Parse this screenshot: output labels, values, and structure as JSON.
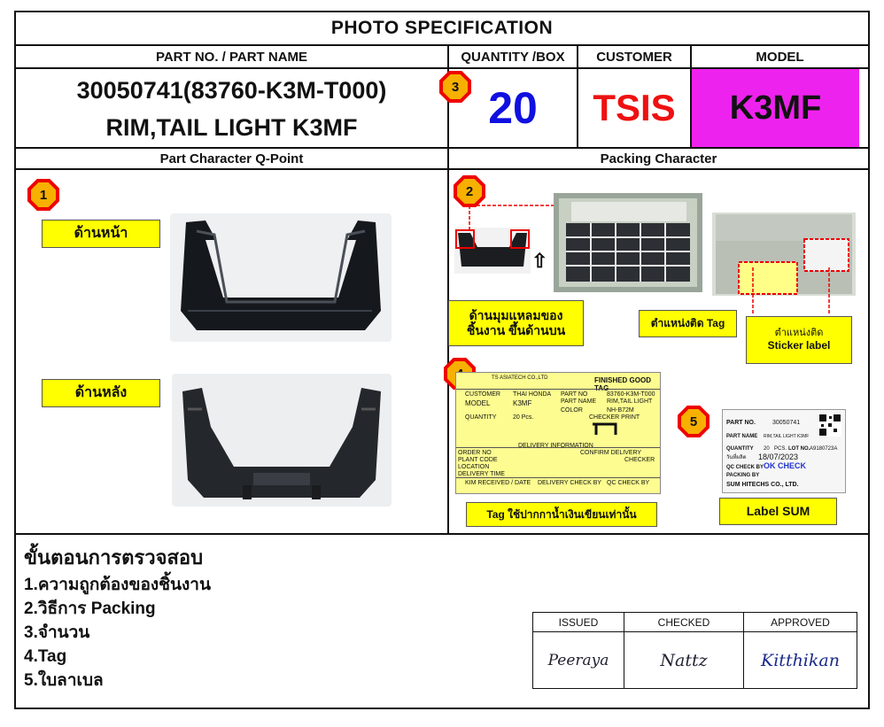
{
  "title": "PHOTO  SPECIFICATION",
  "headers": {
    "part": "PART NO. / PART NAME",
    "quantity": "QUANTITY /BOX",
    "customer": "CUSTOMER",
    "model": "MODEL"
  },
  "part": {
    "number": "30050741(83760-K3M-T000)",
    "name": "RIM,TAIL LIGHT K3MF"
  },
  "quantity": "20",
  "customer": "TSIS",
  "model": "K3MF",
  "colors": {
    "quantity": "#1010e0",
    "customer": "#ee1111",
    "model_bg": "#ee22ee",
    "marker_red": "#ee0000",
    "marker_orange": "#f7b000",
    "note_yellow": "#ffff00"
  },
  "sections": {
    "left": "Part Character Q-Point",
    "right": "Packing Character"
  },
  "markers": [
    "1",
    "2",
    "3",
    "4",
    "5"
  ],
  "labels": {
    "front": "ด้านหน้า",
    "back": "ด้านหลัง",
    "corner": "ด้านมุมแหลมของ\nชิ้นงาน ขึ้นด้านบน",
    "tag_pos": "ตำแหน่งติด Tag",
    "sticker_pos_line1": "ตำแหน่งติด",
    "sticker_pos_line2": "Sticker label",
    "tag_note": "Tag ใช้ปากกาน้ำเงินเขียนเท่านั้น",
    "label_sum": "Label SUM"
  },
  "tag_card": {
    "heading": "FINISHED GOOD TAG",
    "company": "TS ASIATECH CO.,LTD",
    "customer_label": "CUSTOMER",
    "customer_value": "THAI HONDA",
    "model_label": "MODEL",
    "model_value": "K3MF",
    "part_no_label": "PART NO",
    "part_no_value": "83760-K3M-T000",
    "part_name_label": "PART NAME",
    "part_name_value": "RIM,TAIL LIGHT",
    "color_label": "COLOR",
    "color_value": "NH-B72M",
    "quantity_label": "QUANTITY",
    "quantity_value": "20 Pcs.",
    "checker_label": "CHECKER PRINT",
    "delivery_label": "DELIVERY INFORMATION",
    "order_no": "ORDER NO",
    "plant_code": "PLANT CODE",
    "location": "LOCATION",
    "delivery_time": "DELIVERY TIME",
    "confirm_delivery": "CONFIRM DELIVERY",
    "checker": "CHECKER",
    "kim_received": "KIM RECEIVED / DATE",
    "delivery_check": "DELIVERY CHECK BY",
    "qc_check": "QC CHECK BY"
  },
  "sum_label": {
    "part_no_label": "PART NO.",
    "part_no_value": "30050741",
    "part_name_label": "PART NAME",
    "part_name_value": "RIM,TAIL LIGHT K3MF",
    "quantity_label": "QUANTITY",
    "quantity_value": "20",
    "pcs": "PCS.",
    "lot_label": "LOT NO.",
    "lot_value": "A9180723A",
    "date_label": "วันที่ผลิต",
    "date_value": "18/07/2023",
    "qc_label": "QC CHECK BY",
    "qc_stamp": "OK CHECK",
    "packing_label": "PACKING BY",
    "company": "SUM HITECHS CO., LTD."
  },
  "procedure": {
    "heading": "ขั้นตอนการตรวจสอบ",
    "steps": [
      "1.ความถูกต้องของชิ้นงาน",
      "2.วิธีการ Packing",
      "3.จำนวน",
      "4.Tag",
      "5.ใบลาเบล"
    ]
  },
  "approval": {
    "issued": "ISSUED",
    "checked": "CHECKED",
    "approved": "APPROVED",
    "issued_sig": "Peeraya",
    "checked_sig": "Nattz",
    "approved_sig": "Kitthikan"
  }
}
